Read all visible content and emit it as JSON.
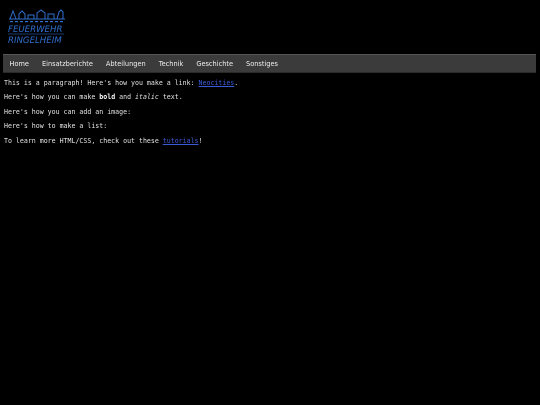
{
  "logo": {
    "line1": "FEUERWEHR",
    "line2": "RINGELHEIM",
    "accent_color": "#2f6fd0",
    "icon": "fire-station-building-icon"
  },
  "nav": {
    "items": [
      {
        "label": "Home"
      },
      {
        "label": "Einsatzberichte"
      },
      {
        "label": "Abteilungen"
      },
      {
        "label": "Technik"
      },
      {
        "label": "Geschichte"
      },
      {
        "label": "Sonstiges"
      }
    ]
  },
  "content": {
    "p1_before": "This is a paragraph! Here's how you make a link: ",
    "p1_link": "Neocities",
    "p1_after": ".",
    "p2_before": "Here's how you can make ",
    "p2_bold": "bold",
    "p2_mid": " and ",
    "p2_italic": "italic",
    "p2_after": " text.",
    "p3": "Here's how you can add an image:",
    "p4": "Here's how to make a list:",
    "p5_before": "To learn more HTML/CSS, check out these ",
    "p5_link": "tutorials",
    "p5_after": "!"
  },
  "colors": {
    "background": "#000000",
    "navbar": "#3b3b3b",
    "link": "#3b5bd6",
    "text": "#e6e6e6"
  }
}
